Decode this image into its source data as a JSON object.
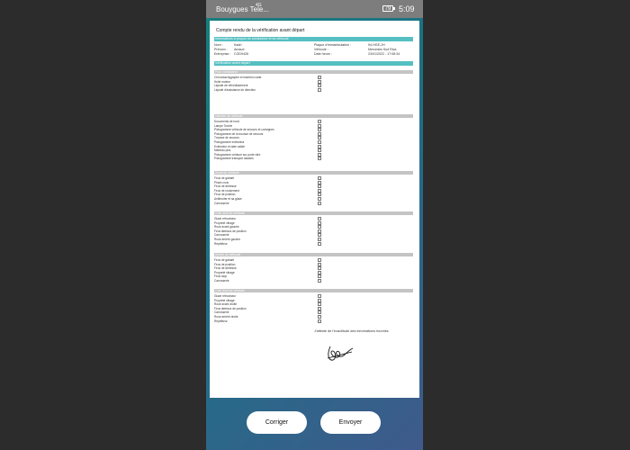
{
  "status_bar": {
    "carrier": "Bouygues Tele...",
    "network": "4G",
    "battery": "79",
    "time": "5:09"
  },
  "document": {
    "title": "Compte rendu de la vérification avant départ",
    "driver_section_title": "Informations à propos du conducteur et du véhicule",
    "driver": {
      "nom_label": "Nom :",
      "nom_value": "Kadri",
      "prenom_label": "Prénom :",
      "prenom_value": "Amaud",
      "entreprise_label": "Entreprise :",
      "entreprise_value": "COD9426",
      "plaque_label": "Plaque d'immatriculation :",
      "plaque_value": "94-HGE-JH",
      "vehicule_label": "Véhicule :",
      "vehicule_value": "Mercedes Sud Rica",
      "date_label": "Date heure :",
      "date_value": "23/01/2022 - 17:08:34"
    },
    "verification_title": "Vérification avant départ",
    "sections": [
      {
        "title": "Pour conducteur",
        "items": [
          "Chronotachygraphe et insertion carte",
          "Huile moteur",
          "Liquide de refroidissement",
          "Liquide d'assistance de direction"
        ]
      },
      {
        "title": "Intérieur du véhicule",
        "items": [
          "Documents de bord",
          "Lampe Torche",
          "Pictogramme véhicule de secours et consignes",
          "Pictogramme de la trousse de secours",
          "Trousse de secours",
          "Pictogramme extincteur",
          "Extincteur et date valide",
          "Marteau pics",
          "Pictogramme ceinture sur porte vitre",
          "Pictogramme transport assises"
        ]
      },
      {
        "title": "Avant du véhicule",
        "items": [
          "Feux de gabarit",
          "Phare croix",
          "Feux de détresse",
          "Feux de croisement",
          "Feux de position",
          "Antibruiter et sa glace",
          "Carrosserie"
        ]
      },
      {
        "title": "Côté droit du véhicule",
        "items": [
          "Glace rétroviseur",
          "Propreté vitrage",
          "Roue avant gauche",
          "Feux latéraux de position",
          "Carrosserie",
          "Roue arrière gauche",
          "Répétiteur"
        ]
      },
      {
        "title": "Arrière du véhicule",
        "items": [
          "Feux de gabarit",
          "Feux de position",
          "Feux de détresse",
          "Propreté vitrage",
          "Feux stop",
          "Carrosserie"
        ]
      },
      {
        "title": "Côté droit du véhicule",
        "items": [
          "Glace rétroviseur",
          "Propreté vitrage",
          "Roue avant droite",
          "Feux latéraux de position",
          "Carrosserie",
          "Roue arrière droite",
          "Répétiteur"
        ]
      }
    ],
    "attestation": "J'atteste de l'exactitude des informations fournies"
  },
  "buttons": {
    "corriger": "Corriger",
    "envoyer": "Envoyer"
  }
}
